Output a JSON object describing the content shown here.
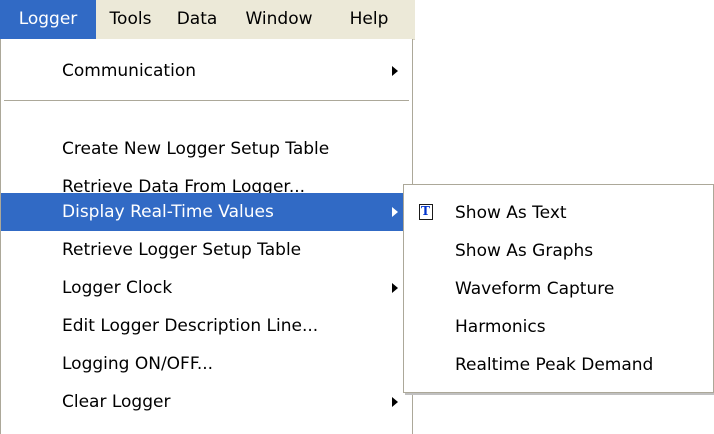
{
  "menubar": {
    "items": [
      {
        "label": "Logger",
        "active": true
      },
      {
        "label": "Tools"
      },
      {
        "label": "Data"
      },
      {
        "label": "Window"
      },
      {
        "label": "Help"
      }
    ]
  },
  "logger_menu": {
    "items": [
      {
        "label": "Communication",
        "has_submenu": true
      },
      {
        "label": "Create New Logger Setup Table"
      },
      {
        "label": "Retrieve Data From Logger..."
      },
      {
        "label": "Display Real-Time Values",
        "has_submenu": true,
        "highlighted": true
      },
      {
        "label": "Retrieve Logger Setup Table"
      },
      {
        "label": "Logger Clock",
        "has_submenu": true
      },
      {
        "label": "Edit Logger Description Line..."
      },
      {
        "label": "Logging ON/OFF..."
      },
      {
        "label": "Clear Logger",
        "has_submenu": true
      }
    ]
  },
  "realtime_submenu": {
    "items": [
      {
        "label": "Show As Text",
        "icon": "text-document-icon"
      },
      {
        "label": "Show As Graphs"
      },
      {
        "label": "Waveform Capture"
      },
      {
        "label": "Harmonics"
      },
      {
        "label": "Realtime Peak Demand"
      }
    ]
  },
  "colors": {
    "highlight": "#316ac5",
    "menubar_bg": "#ece9d8",
    "border": "#aca899"
  }
}
